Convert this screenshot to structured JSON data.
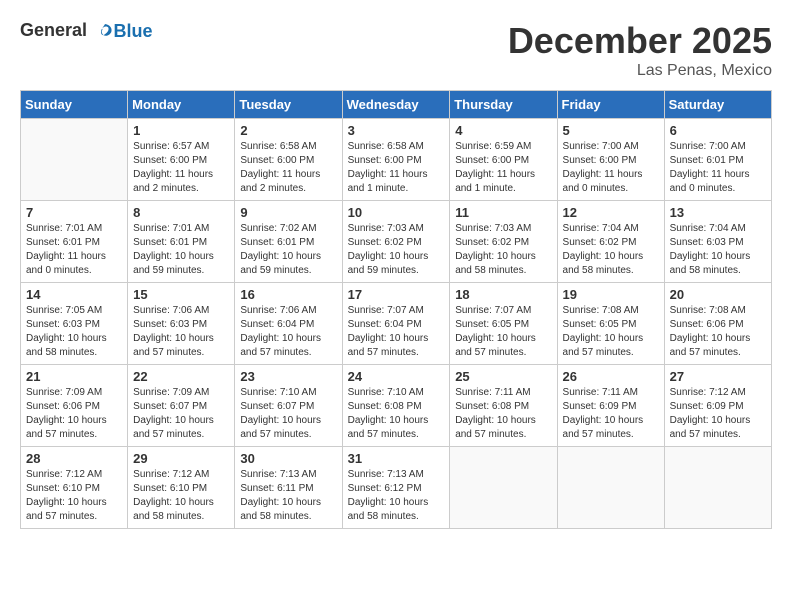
{
  "header": {
    "logo_general": "General",
    "logo_blue": "Blue",
    "month": "December 2025",
    "location": "Las Penas, Mexico"
  },
  "weekdays": [
    "Sunday",
    "Monday",
    "Tuesday",
    "Wednesday",
    "Thursday",
    "Friday",
    "Saturday"
  ],
  "weeks": [
    [
      {
        "day": "",
        "sunrise": "",
        "sunset": "",
        "daylight": ""
      },
      {
        "day": "1",
        "sunrise": "6:57 AM",
        "sunset": "6:00 PM",
        "daylight": "11 hours and 2 minutes."
      },
      {
        "day": "2",
        "sunrise": "6:58 AM",
        "sunset": "6:00 PM",
        "daylight": "11 hours and 2 minutes."
      },
      {
        "day": "3",
        "sunrise": "6:58 AM",
        "sunset": "6:00 PM",
        "daylight": "11 hours and 1 minute."
      },
      {
        "day": "4",
        "sunrise": "6:59 AM",
        "sunset": "6:00 PM",
        "daylight": "11 hours and 1 minute."
      },
      {
        "day": "5",
        "sunrise": "7:00 AM",
        "sunset": "6:00 PM",
        "daylight": "11 hours and 0 minutes."
      },
      {
        "day": "6",
        "sunrise": "7:00 AM",
        "sunset": "6:01 PM",
        "daylight": "11 hours and 0 minutes."
      }
    ],
    [
      {
        "day": "7",
        "sunrise": "7:01 AM",
        "sunset": "6:01 PM",
        "daylight": "11 hours and 0 minutes."
      },
      {
        "day": "8",
        "sunrise": "7:01 AM",
        "sunset": "6:01 PM",
        "daylight": "10 hours and 59 minutes."
      },
      {
        "day": "9",
        "sunrise": "7:02 AM",
        "sunset": "6:01 PM",
        "daylight": "10 hours and 59 minutes."
      },
      {
        "day": "10",
        "sunrise": "7:03 AM",
        "sunset": "6:02 PM",
        "daylight": "10 hours and 59 minutes."
      },
      {
        "day": "11",
        "sunrise": "7:03 AM",
        "sunset": "6:02 PM",
        "daylight": "10 hours and 58 minutes."
      },
      {
        "day": "12",
        "sunrise": "7:04 AM",
        "sunset": "6:02 PM",
        "daylight": "10 hours and 58 minutes."
      },
      {
        "day": "13",
        "sunrise": "7:04 AM",
        "sunset": "6:03 PM",
        "daylight": "10 hours and 58 minutes."
      }
    ],
    [
      {
        "day": "14",
        "sunrise": "7:05 AM",
        "sunset": "6:03 PM",
        "daylight": "10 hours and 58 minutes."
      },
      {
        "day": "15",
        "sunrise": "7:06 AM",
        "sunset": "6:03 PM",
        "daylight": "10 hours and 57 minutes."
      },
      {
        "day": "16",
        "sunrise": "7:06 AM",
        "sunset": "6:04 PM",
        "daylight": "10 hours and 57 minutes."
      },
      {
        "day": "17",
        "sunrise": "7:07 AM",
        "sunset": "6:04 PM",
        "daylight": "10 hours and 57 minutes."
      },
      {
        "day": "18",
        "sunrise": "7:07 AM",
        "sunset": "6:05 PM",
        "daylight": "10 hours and 57 minutes."
      },
      {
        "day": "19",
        "sunrise": "7:08 AM",
        "sunset": "6:05 PM",
        "daylight": "10 hours and 57 minutes."
      },
      {
        "day": "20",
        "sunrise": "7:08 AM",
        "sunset": "6:06 PM",
        "daylight": "10 hours and 57 minutes."
      }
    ],
    [
      {
        "day": "21",
        "sunrise": "7:09 AM",
        "sunset": "6:06 PM",
        "daylight": "10 hours and 57 minutes."
      },
      {
        "day": "22",
        "sunrise": "7:09 AM",
        "sunset": "6:07 PM",
        "daylight": "10 hours and 57 minutes."
      },
      {
        "day": "23",
        "sunrise": "7:10 AM",
        "sunset": "6:07 PM",
        "daylight": "10 hours and 57 minutes."
      },
      {
        "day": "24",
        "sunrise": "7:10 AM",
        "sunset": "6:08 PM",
        "daylight": "10 hours and 57 minutes."
      },
      {
        "day": "25",
        "sunrise": "7:11 AM",
        "sunset": "6:08 PM",
        "daylight": "10 hours and 57 minutes."
      },
      {
        "day": "26",
        "sunrise": "7:11 AM",
        "sunset": "6:09 PM",
        "daylight": "10 hours and 57 minutes."
      },
      {
        "day": "27",
        "sunrise": "7:12 AM",
        "sunset": "6:09 PM",
        "daylight": "10 hours and 57 minutes."
      }
    ],
    [
      {
        "day": "28",
        "sunrise": "7:12 AM",
        "sunset": "6:10 PM",
        "daylight": "10 hours and 57 minutes."
      },
      {
        "day": "29",
        "sunrise": "7:12 AM",
        "sunset": "6:10 PM",
        "daylight": "10 hours and 58 minutes."
      },
      {
        "day": "30",
        "sunrise": "7:13 AM",
        "sunset": "6:11 PM",
        "daylight": "10 hours and 58 minutes."
      },
      {
        "day": "31",
        "sunrise": "7:13 AM",
        "sunset": "6:12 PM",
        "daylight": "10 hours and 58 minutes."
      },
      {
        "day": "",
        "sunrise": "",
        "sunset": "",
        "daylight": ""
      },
      {
        "day": "",
        "sunrise": "",
        "sunset": "",
        "daylight": ""
      },
      {
        "day": "",
        "sunrise": "",
        "sunset": "",
        "daylight": ""
      }
    ]
  ]
}
